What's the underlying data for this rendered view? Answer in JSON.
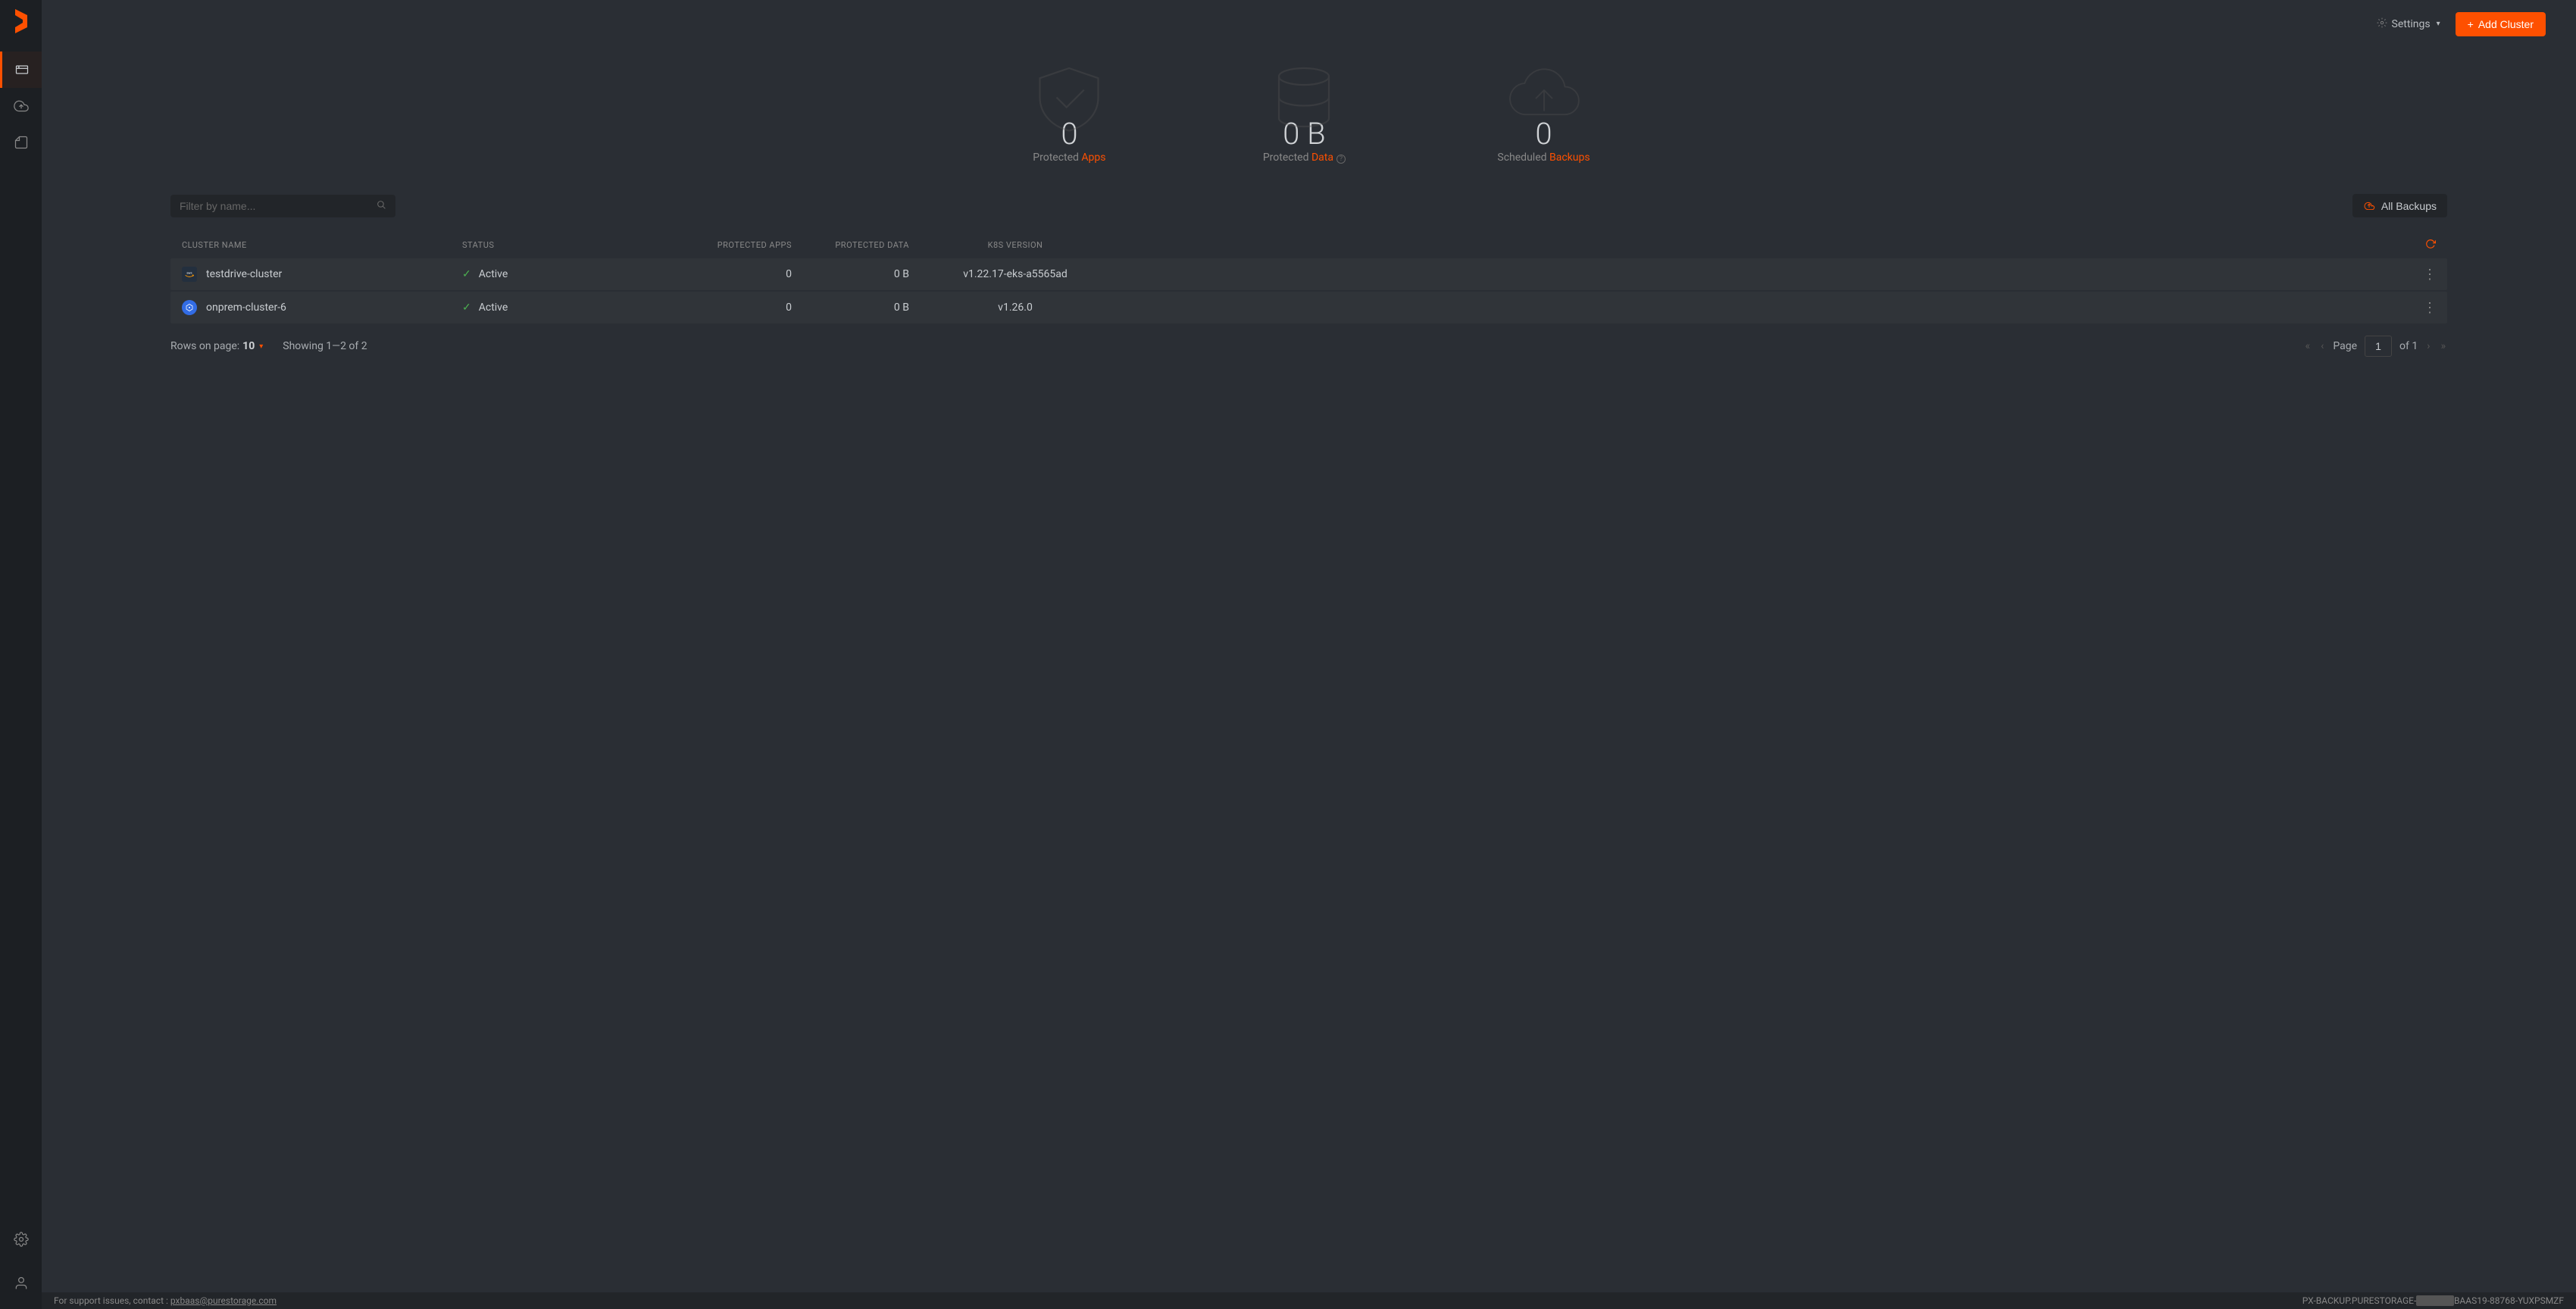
{
  "header": {
    "settings_label": "Settings",
    "add_cluster_label": "Add Cluster"
  },
  "stats": {
    "protected_apps": {
      "value": "0",
      "label_prefix": "Protected",
      "label_accent": "Apps"
    },
    "protected_data": {
      "value": "0 B",
      "label_prefix": "Protected",
      "label_accent": "Data"
    },
    "scheduled_backups": {
      "value": "0",
      "label_prefix": "Scheduled",
      "label_accent": "Backups"
    }
  },
  "toolbar": {
    "filter_placeholder": "Filter by name...",
    "all_backups_label": "All Backups"
  },
  "table": {
    "headers": {
      "name": "CLUSTER NAME",
      "status": "STATUS",
      "apps": "PROTECTED APPS",
      "data": "PROTECTED DATA",
      "version": "K8S VERSION"
    },
    "rows": [
      {
        "provider": "aws",
        "name": "testdrive-cluster",
        "status": "Active",
        "apps": "0",
        "data": "0 B",
        "version": "v1.22.17-eks-a5565ad"
      },
      {
        "provider": "k8s",
        "name": "onprem-cluster-6",
        "status": "Active",
        "apps": "0",
        "data": "0 B",
        "version": "v1.26.0"
      }
    ]
  },
  "pagination": {
    "rows_label": "Rows on page:",
    "rows_value": "10",
    "showing": "Showing 1—2 of 2",
    "page_label": "Page",
    "page_value": "1",
    "page_total": "of 1"
  },
  "footer": {
    "support_prefix": "For support issues, contact : ",
    "support_email": "pxbaas@purestorage.com",
    "host_prefix": "PX-BACKUP.PURESTORAGE-",
    "host_suffix": "BAAS19-88768-YUXPSMZF"
  }
}
